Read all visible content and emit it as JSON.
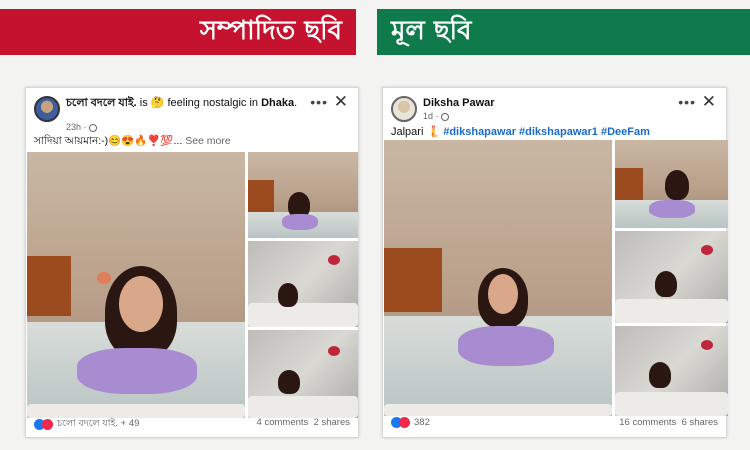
{
  "banners": {
    "edited": "সম্পাদিত ছবি",
    "original": "মূল ছবি"
  },
  "edited_post": {
    "name": "চলো বদলে যাই.",
    "status": "is 🤔 feeling nostalgic in",
    "place": "Dhaka",
    "time": "23h ·",
    "caption": "সাদিয়া আয়মান:-)😊😍🔥❣️💯...",
    "see_more": "See more",
    "reactions": "চলো বদলে যাই. + 49",
    "comments": "4 comments",
    "shares": "2 shares",
    "menu_icon": "more-dots-icon",
    "close_icon": "close-icon"
  },
  "original_post": {
    "name": "Diksha Pawar",
    "time": "1d ·",
    "caption_text": "Jalpari 🧜",
    "hashtags": "#dikshapawar #dikshapawar1 #DeeFam",
    "reactions": "382",
    "comments": "16 comments",
    "shares": "6 shares",
    "menu_icon": "more-dots-icon",
    "close_icon": "close-icon"
  },
  "colors": {
    "edited_banner": "#c4122f",
    "original_banner": "#0f7a4c",
    "link_blue": "#1b6ac9"
  }
}
